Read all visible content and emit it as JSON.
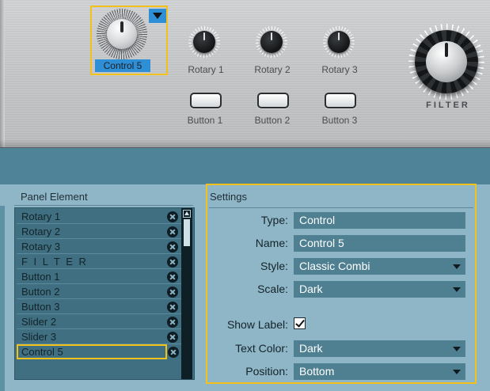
{
  "panel": {
    "selected_control": {
      "label": "Control 5"
    },
    "rotaries": [
      {
        "label": "Rotary 1"
      },
      {
        "label": "Rotary 2"
      },
      {
        "label": "Rotary 3"
      }
    ],
    "buttons": [
      {
        "label": "Button 1"
      },
      {
        "label": "Button 2"
      },
      {
        "label": "Button 3"
      }
    ],
    "filter_knob": {
      "label": "FILTER"
    }
  },
  "panel_elements": {
    "title": "Panel Element",
    "items": [
      {
        "label": "Rotary 1"
      },
      {
        "label": "Rotary 2"
      },
      {
        "label": "Rotary 3"
      },
      {
        "label": "F I L T E R"
      },
      {
        "label": "Button 1"
      },
      {
        "label": "Button 2"
      },
      {
        "label": "Button 3"
      },
      {
        "label": "Slider 2"
      },
      {
        "label": "Slider 3"
      },
      {
        "label": "Control 5",
        "selected": true
      }
    ]
  },
  "settings": {
    "title": "Settings",
    "type": {
      "label": "Type:",
      "value": "Control"
    },
    "name": {
      "label": "Name:",
      "value": "Control 5"
    },
    "style": {
      "label": "Style:",
      "value": "Classic Combi"
    },
    "scale": {
      "label": "Scale:",
      "value": "Dark"
    },
    "show_label": {
      "label": "Show Label:",
      "checked": true
    },
    "text_color": {
      "label": "Text Color:",
      "value": "Dark"
    },
    "position": {
      "label": "Position:",
      "value": "Bottom"
    }
  },
  "colors": {
    "selection_highlight": "#f2c21b",
    "selection_blue": "#2f8fd6",
    "editor_bg": "#8fb6c6",
    "field_bg": "#4e8092"
  }
}
